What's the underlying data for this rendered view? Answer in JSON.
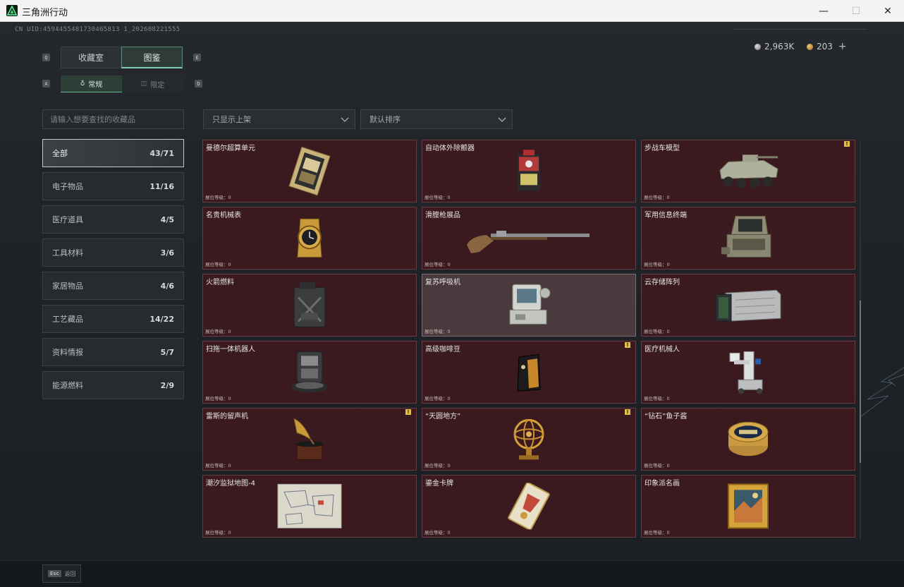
{
  "window": {
    "title": "三角洲行动",
    "minimize": "—",
    "maximize": "☐",
    "close": "✕"
  },
  "header": {
    "uid": "CN UID:4594455481730465813 1_2026082215 55",
    "uid_display": "CN UID:4594455481730465813 1_202608221555",
    "currency": [
      {
        "name": "silver-coin",
        "value": "2,963K"
      },
      {
        "name": "gold-coin",
        "value": "203"
      }
    ],
    "currency_add": "+"
  },
  "tabs": {
    "main": [
      {
        "label": "收藏室",
        "key": "Q",
        "active": false
      },
      {
        "label": "图鉴",
        "key": "E",
        "active": true
      }
    ],
    "sub": [
      {
        "label": "常规",
        "key": "A",
        "active": true
      },
      {
        "label": "限定",
        "key": "D",
        "active": false
      }
    ]
  },
  "search": {
    "placeholder": "请输入想要查找的收藏品"
  },
  "sidebar": {
    "items": [
      {
        "label": "全部",
        "count": "43/71",
        "active": true
      },
      {
        "label": "电子物品",
        "count": "11/16"
      },
      {
        "label": "医疗道具",
        "count": "4/5"
      },
      {
        "label": "工具材料",
        "count": "3/6"
      },
      {
        "label": "家居物品",
        "count": "4/6"
      },
      {
        "label": "工艺藏品",
        "count": "14/22"
      },
      {
        "label": "资料情报",
        "count": "5/7"
      },
      {
        "label": "能源燃料",
        "count": "2/9"
      }
    ]
  },
  "filters": {
    "shelf_filter": "只显示上架",
    "sort": "默认排序"
  },
  "items": [
    {
      "name": "曼德尔超算单元",
      "level": "展位等级：0",
      "icon": "supercomputer-chip-icon",
      "alert": false
    },
    {
      "name": "自动体外除颤器",
      "level": "展位等级：0",
      "icon": "defibrillator-icon",
      "alert": false
    },
    {
      "name": "步战车模型",
      "level": "展位等级：0",
      "icon": "ifv-model-icon",
      "alert": true
    },
    {
      "name": "名贵机械表",
      "level": "展位等级：0",
      "icon": "luxury-watch-icon",
      "alert": false
    },
    {
      "name": "滑膛枪展品",
      "level": "展位等级：0",
      "icon": "musket-icon",
      "alert": false
    },
    {
      "name": "军用信息终端",
      "level": "展位等级：0",
      "icon": "military-terminal-icon",
      "alert": false
    },
    {
      "name": "火箭燃料",
      "level": "展位等级：0",
      "icon": "fuel-jerrycan-icon",
      "alert": false
    },
    {
      "name": "复苏呼吸机",
      "level": "展位等级：0",
      "icon": "ventilator-icon",
      "alert": false,
      "highlight": true
    },
    {
      "name": "云存储阵列",
      "level": "展位等级：0",
      "icon": "storage-array-icon",
      "alert": false
    },
    {
      "name": "扫拖一体机器人",
      "level": "展位等级：0",
      "icon": "mop-robot-icon",
      "alert": false
    },
    {
      "name": "高级咖啡豆",
      "level": "展位等级：0",
      "icon": "coffee-bean-bag-icon",
      "alert": true
    },
    {
      "name": "医疗机械人",
      "level": "展位等级：0",
      "icon": "medical-robot-icon",
      "alert": false
    },
    {
      "name": "雷斯的留声机",
      "level": "展位等级：0",
      "icon": "gramophone-icon",
      "alert": true
    },
    {
      "name": "“天圆地方”",
      "level": "展位等级：0",
      "icon": "armillary-sphere-icon",
      "alert": true
    },
    {
      "name": "“钻石”鱼子酱",
      "level": "展位等级：0",
      "icon": "caviar-tin-icon",
      "alert": false
    },
    {
      "name": "潮汐监狱地图-4",
      "level": "展位等级：0",
      "icon": "prison-map-icon",
      "alert": false
    },
    {
      "name": "鎏金卡牌",
      "level": "展位等级：0",
      "icon": "gilded-card-icon",
      "alert": false
    },
    {
      "name": "印象派名画",
      "level": "展位等级：0",
      "icon": "framed-painting-icon",
      "alert": false
    }
  ],
  "alert_glyph": "!",
  "footer": {
    "esc_key": "Esc",
    "esc_label": "返回"
  }
}
